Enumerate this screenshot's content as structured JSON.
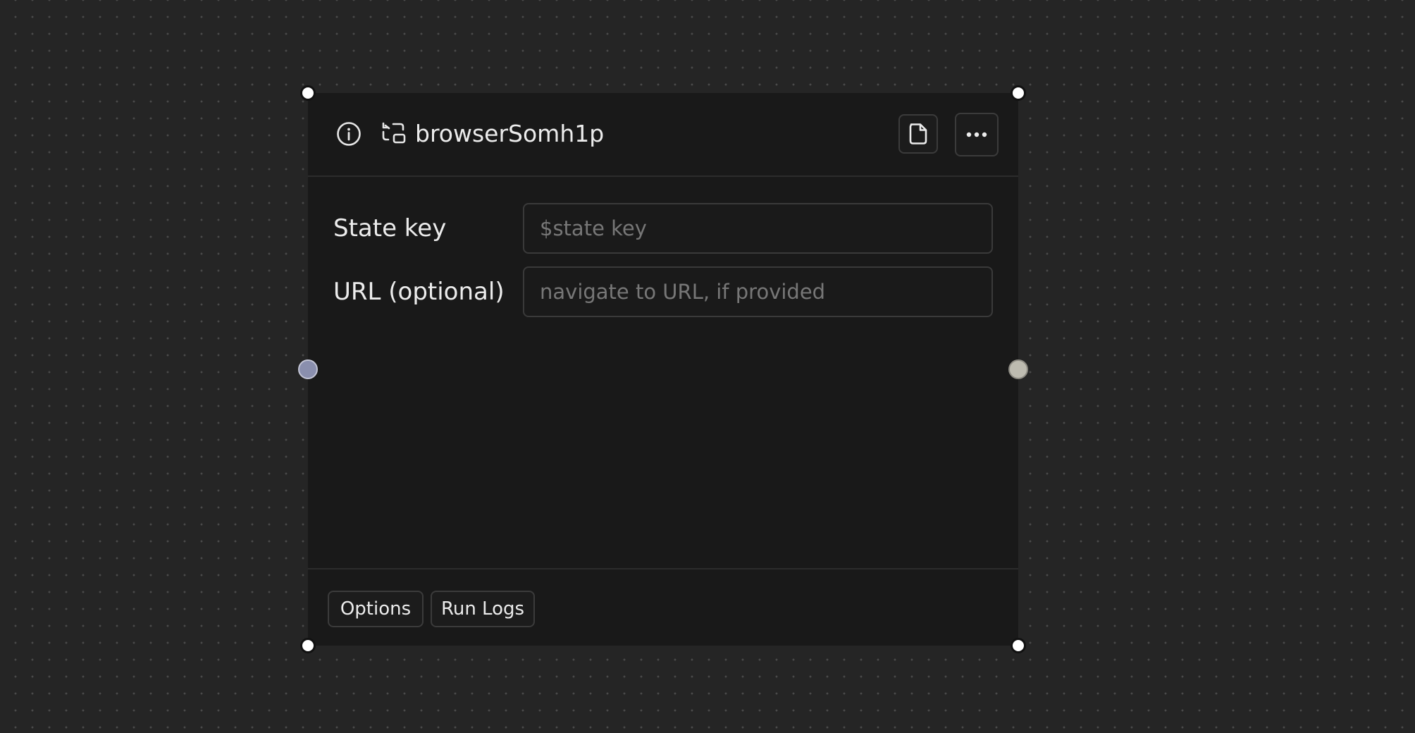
{
  "node": {
    "title": "browserSomh1p",
    "header_icons": {
      "info": "info-icon",
      "type": "browser-swap-icon",
      "note": "note-icon",
      "more": "more-horizontal-icon"
    },
    "fields": [
      {
        "label": "State key",
        "value": "",
        "placeholder": "$state key"
      },
      {
        "label": "URL (optional)",
        "value": "",
        "placeholder": "navigate to URL, if provided"
      }
    ],
    "footer": {
      "tabs": [
        {
          "label": "Options"
        },
        {
          "label": "Run Logs"
        }
      ]
    }
  },
  "colors": {
    "canvas": "#252525",
    "node_bg": "#191919",
    "input_port": "#8a8fae",
    "output_port": "#bdbbb0"
  }
}
